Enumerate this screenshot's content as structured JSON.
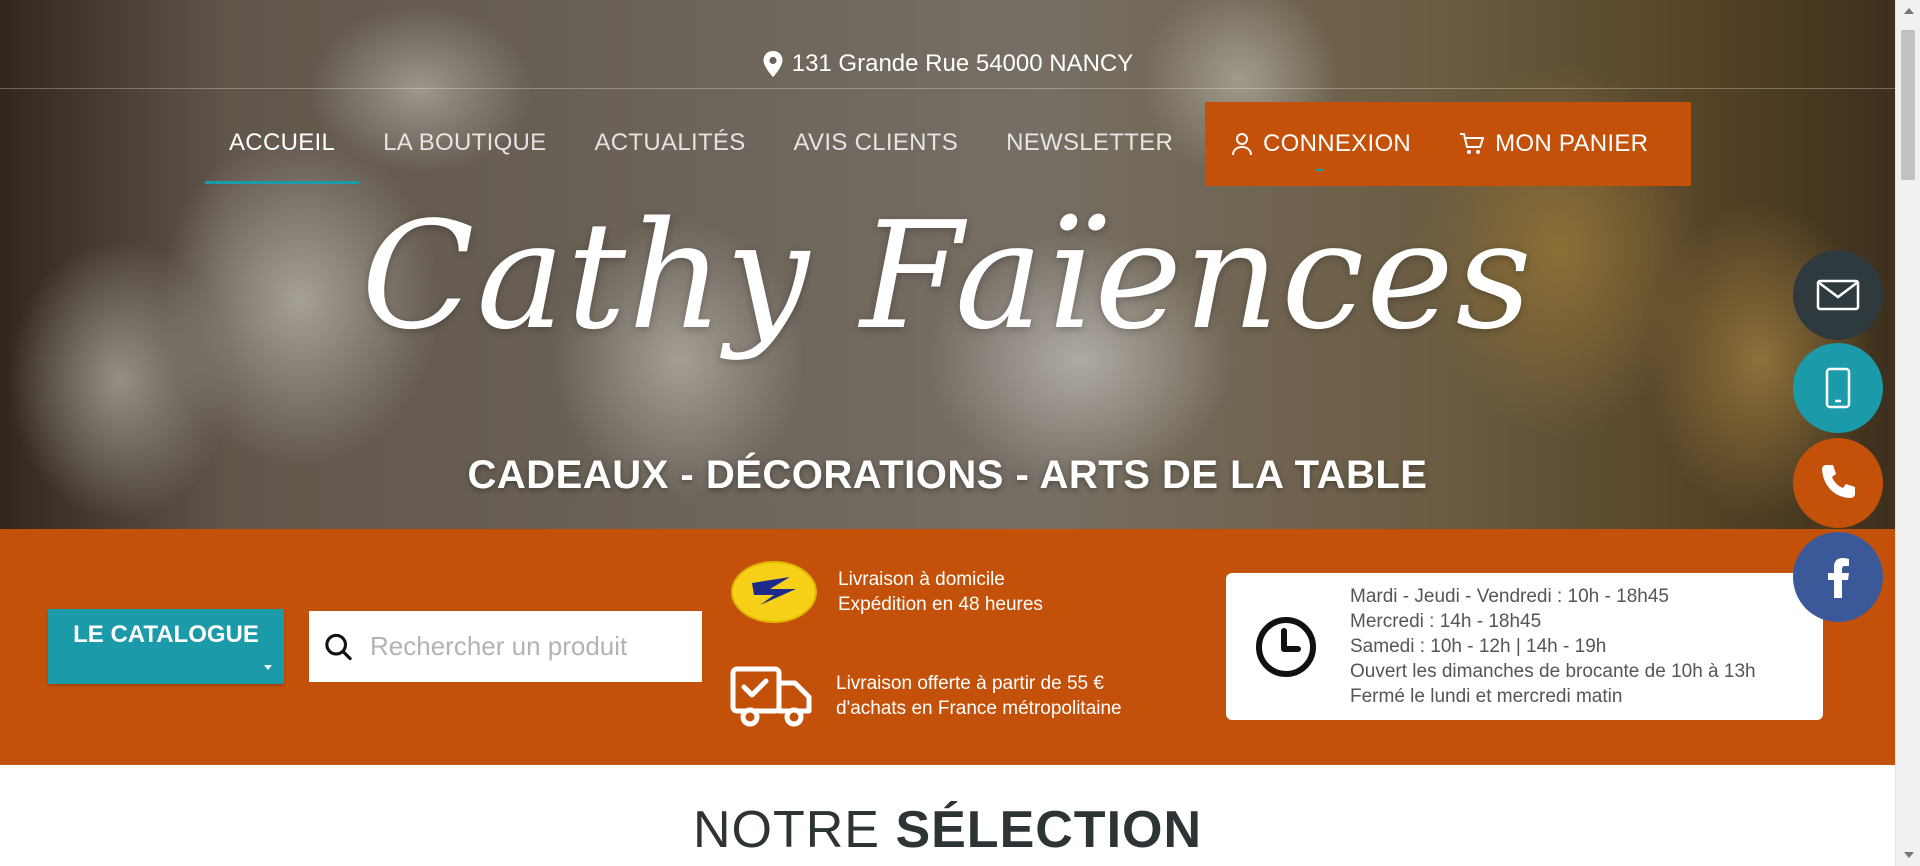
{
  "header": {
    "address": "131 Grande Rue 54000 NANCY",
    "nav": [
      {
        "label": "ACCUEIL",
        "active": true
      },
      {
        "label": "LA BOUTIQUE"
      },
      {
        "label": "ACTUALITÉS"
      },
      {
        "label": "AVIS CLIENTS"
      },
      {
        "label": "NEWSLETTER"
      }
    ],
    "connexion": "CONNEXION",
    "panier": "MON PANIER"
  },
  "hero": {
    "logo": "Cathy Faïences",
    "tagline": "CADEAUX - DÉCORATIONS - ARTS DE LA TABLE"
  },
  "band": {
    "catalogue": "LE CATALOGUE",
    "search_placeholder": "Rechercher un produit",
    "delivery": {
      "line1": "Livraison à domicile",
      "line2": "Expédition en 48 heures"
    },
    "free_shipping": {
      "line1": "Livraison offerte à partir de 55 €",
      "line2": "d'achats en France métropolitaine"
    },
    "hours": [
      "Mardi - Jeudi - Vendredi : 10h - 18h45",
      "Mercredi : 14h - 18h45",
      "Samedi : 10h - 12h | 14h - 19h",
      "Ouvert les dimanches de brocante de 10h à 13h",
      "Fermé le lundi et mercredi matin"
    ]
  },
  "side_buttons": [
    "mail-icon",
    "mobile-icon",
    "phone-icon",
    "facebook-icon"
  ],
  "section": {
    "title_light": "NOTRE",
    "title_bold": "SÉLECTION"
  },
  "colors": {
    "orange": "#c4510a",
    "teal": "#1b9aaa",
    "dark": "#2f3a3e",
    "facebook": "#3b5998"
  }
}
